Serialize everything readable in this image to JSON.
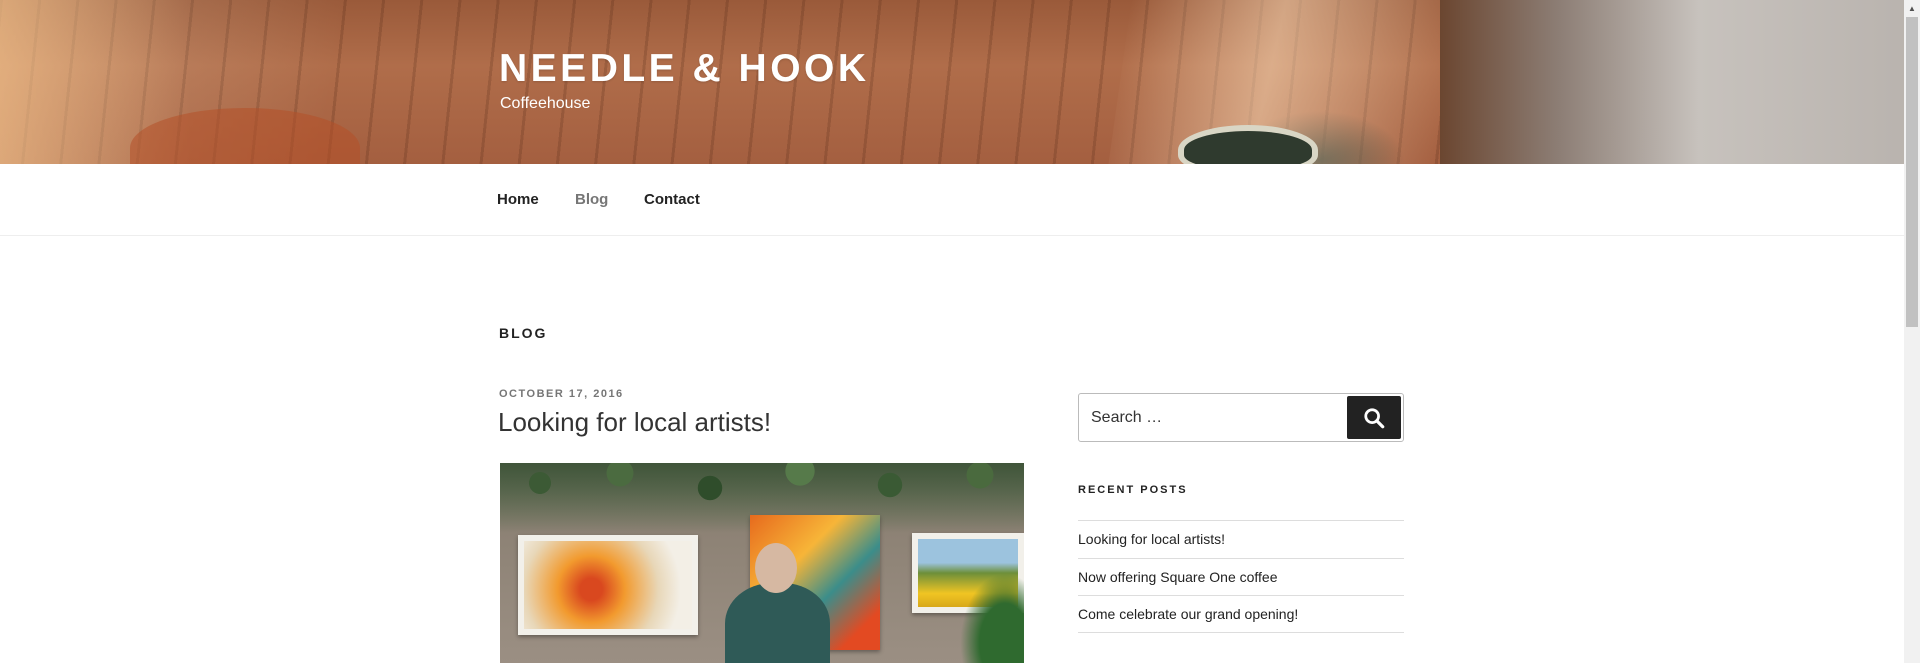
{
  "site": {
    "title": "NEEDLE & HOOK",
    "tagline": "Coffeehouse"
  },
  "nav": {
    "items": [
      {
        "label": "Home",
        "current": false
      },
      {
        "label": "Blog",
        "current": true
      },
      {
        "label": "Contact",
        "current": false
      }
    ]
  },
  "page": {
    "heading": "BLOG"
  },
  "post": {
    "date": "OCTOBER 17, 2016",
    "title": "Looking for local artists!",
    "image_icon": "post-featured-image"
  },
  "sidebar": {
    "search": {
      "placeholder": "Search …",
      "button_icon": "search-icon"
    },
    "recent_posts": {
      "title": "RECENT POSTS",
      "items": [
        "Looking for local artists!",
        "Now offering Square One coffee",
        "Come celebrate our grand opening!"
      ]
    }
  },
  "colors": {
    "text": "#222222",
    "muted": "#767676",
    "button": "#222222",
    "border": "#dddddd"
  }
}
